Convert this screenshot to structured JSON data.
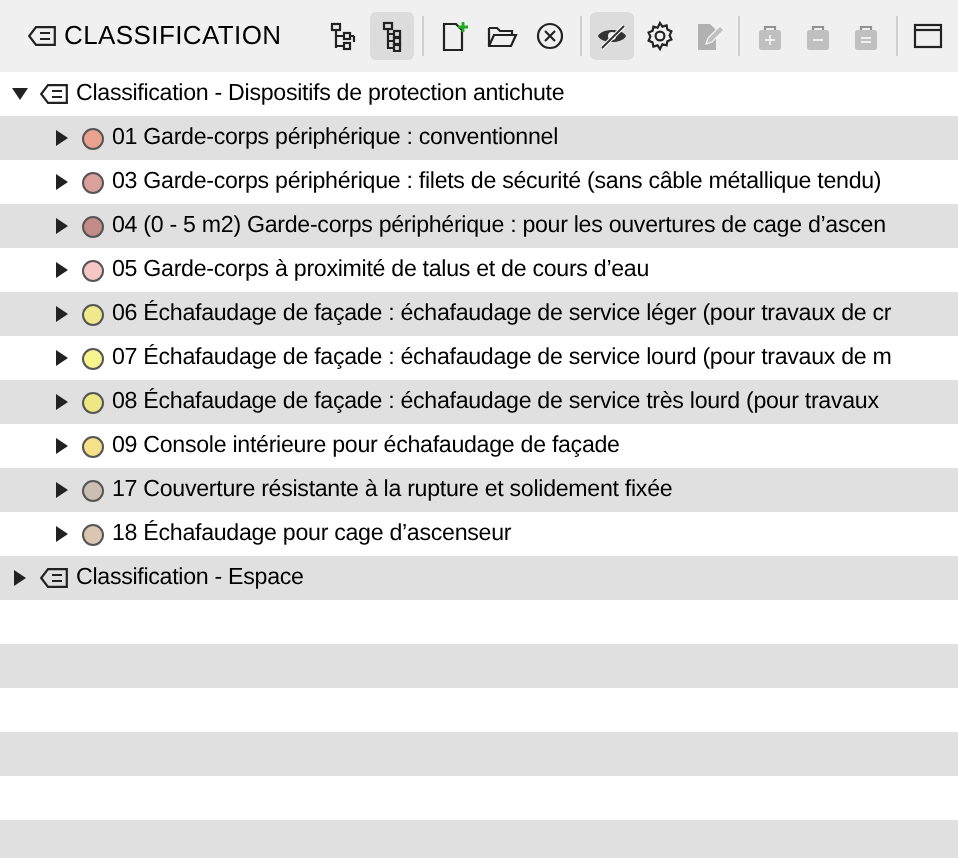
{
  "panel": {
    "title": "CLASSIFICATION"
  },
  "toolbar": [
    {
      "kind": "tree-horizontal",
      "active": false,
      "disabled": false
    },
    {
      "kind": "tree-vertical",
      "active": true,
      "disabled": false
    },
    {
      "kind": "new",
      "active": false,
      "disabled": false
    },
    {
      "kind": "open",
      "active": false,
      "disabled": false
    },
    {
      "kind": "close",
      "active": false,
      "disabled": false
    },
    {
      "kind": "hide",
      "active": true,
      "disabled": false
    },
    {
      "kind": "settings",
      "active": false,
      "disabled": false
    },
    {
      "kind": "edit",
      "active": false,
      "disabled": true
    },
    {
      "kind": "bag-add",
      "active": false,
      "disabled": true
    },
    {
      "kind": "bag-remove",
      "active": false,
      "disabled": true
    },
    {
      "kind": "bag-equal",
      "active": false,
      "disabled": true
    },
    {
      "kind": "window",
      "active": false,
      "disabled": false
    }
  ],
  "tree": [
    {
      "label": "Classification - Dispositifs de protection antichute",
      "expanded": true,
      "children": [
        {
          "label": "01 Garde-corps périphérique : conventionnel",
          "color": "#eba28e",
          "expanded": false
        },
        {
          "label": "03 Garde-corps périphérique : filets de sécurité (sans câble métallique tendu)",
          "color": "#d9a09c",
          "expanded": false
        },
        {
          "label": "04 (0 - 5 m2) Garde-corps périphérique : pour les ouvertures de cage d’ascen",
          "color": "#c48a88",
          "expanded": false
        },
        {
          "label": "05 Garde-corps à proximité de talus et de cours d’eau",
          "color": "#f6c6c4",
          "expanded": false
        },
        {
          "label": "06 Échafaudage de façade : échafaudage de service léger (pour travaux de cr",
          "color": "#eee98a",
          "expanded": false
        },
        {
          "label": "07 Échafaudage de façade : échafaudage de service lourd (pour travaux de m",
          "color": "#f8f48e",
          "expanded": false
        },
        {
          "label": "08 Échafaudage de façade : échafaudage de service très lourd (pour travaux",
          "color": "#ece884",
          "expanded": false
        },
        {
          "label": "09 Console intérieure pour échafaudage de façade",
          "color": "#f6e08a",
          "expanded": false
        },
        {
          "label": "17 Couverture résistante à la rupture et solidement fixée",
          "color": "#cbbfb3",
          "expanded": false
        },
        {
          "label": "18 Échafaudage pour cage d’ascenseur",
          "color": "#dbc6b2",
          "expanded": false
        }
      ]
    },
    {
      "label": "Classification - Espace",
      "expanded": false
    }
  ]
}
